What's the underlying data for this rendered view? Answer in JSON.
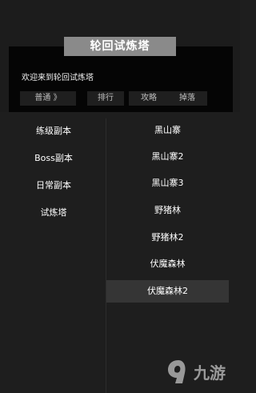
{
  "title": "轮回试炼塔",
  "header": {
    "welcome": "欢迎来到轮回试炼塔",
    "tabs": [
      "普通 》",
      "排行",
      "攻略",
      "掉落"
    ]
  },
  "categories": [
    "练级副本",
    "Boss副本",
    "日常副本",
    "试炼塔"
  ],
  "maps": [
    "黑山寨",
    "黑山寨2",
    "黑山寨3",
    "野猪林",
    "野猪林2",
    "伏魔森林",
    "伏魔森林2"
  ],
  "selected_map_index": 6,
  "watermark": {
    "text": "九游",
    "icon": "nine-game-logo-icon"
  },
  "colors": {
    "background": "#1e1e1e",
    "header_panel": "#050505",
    "title_tab": "#8a8a8a",
    "selected_row": "#353535"
  }
}
